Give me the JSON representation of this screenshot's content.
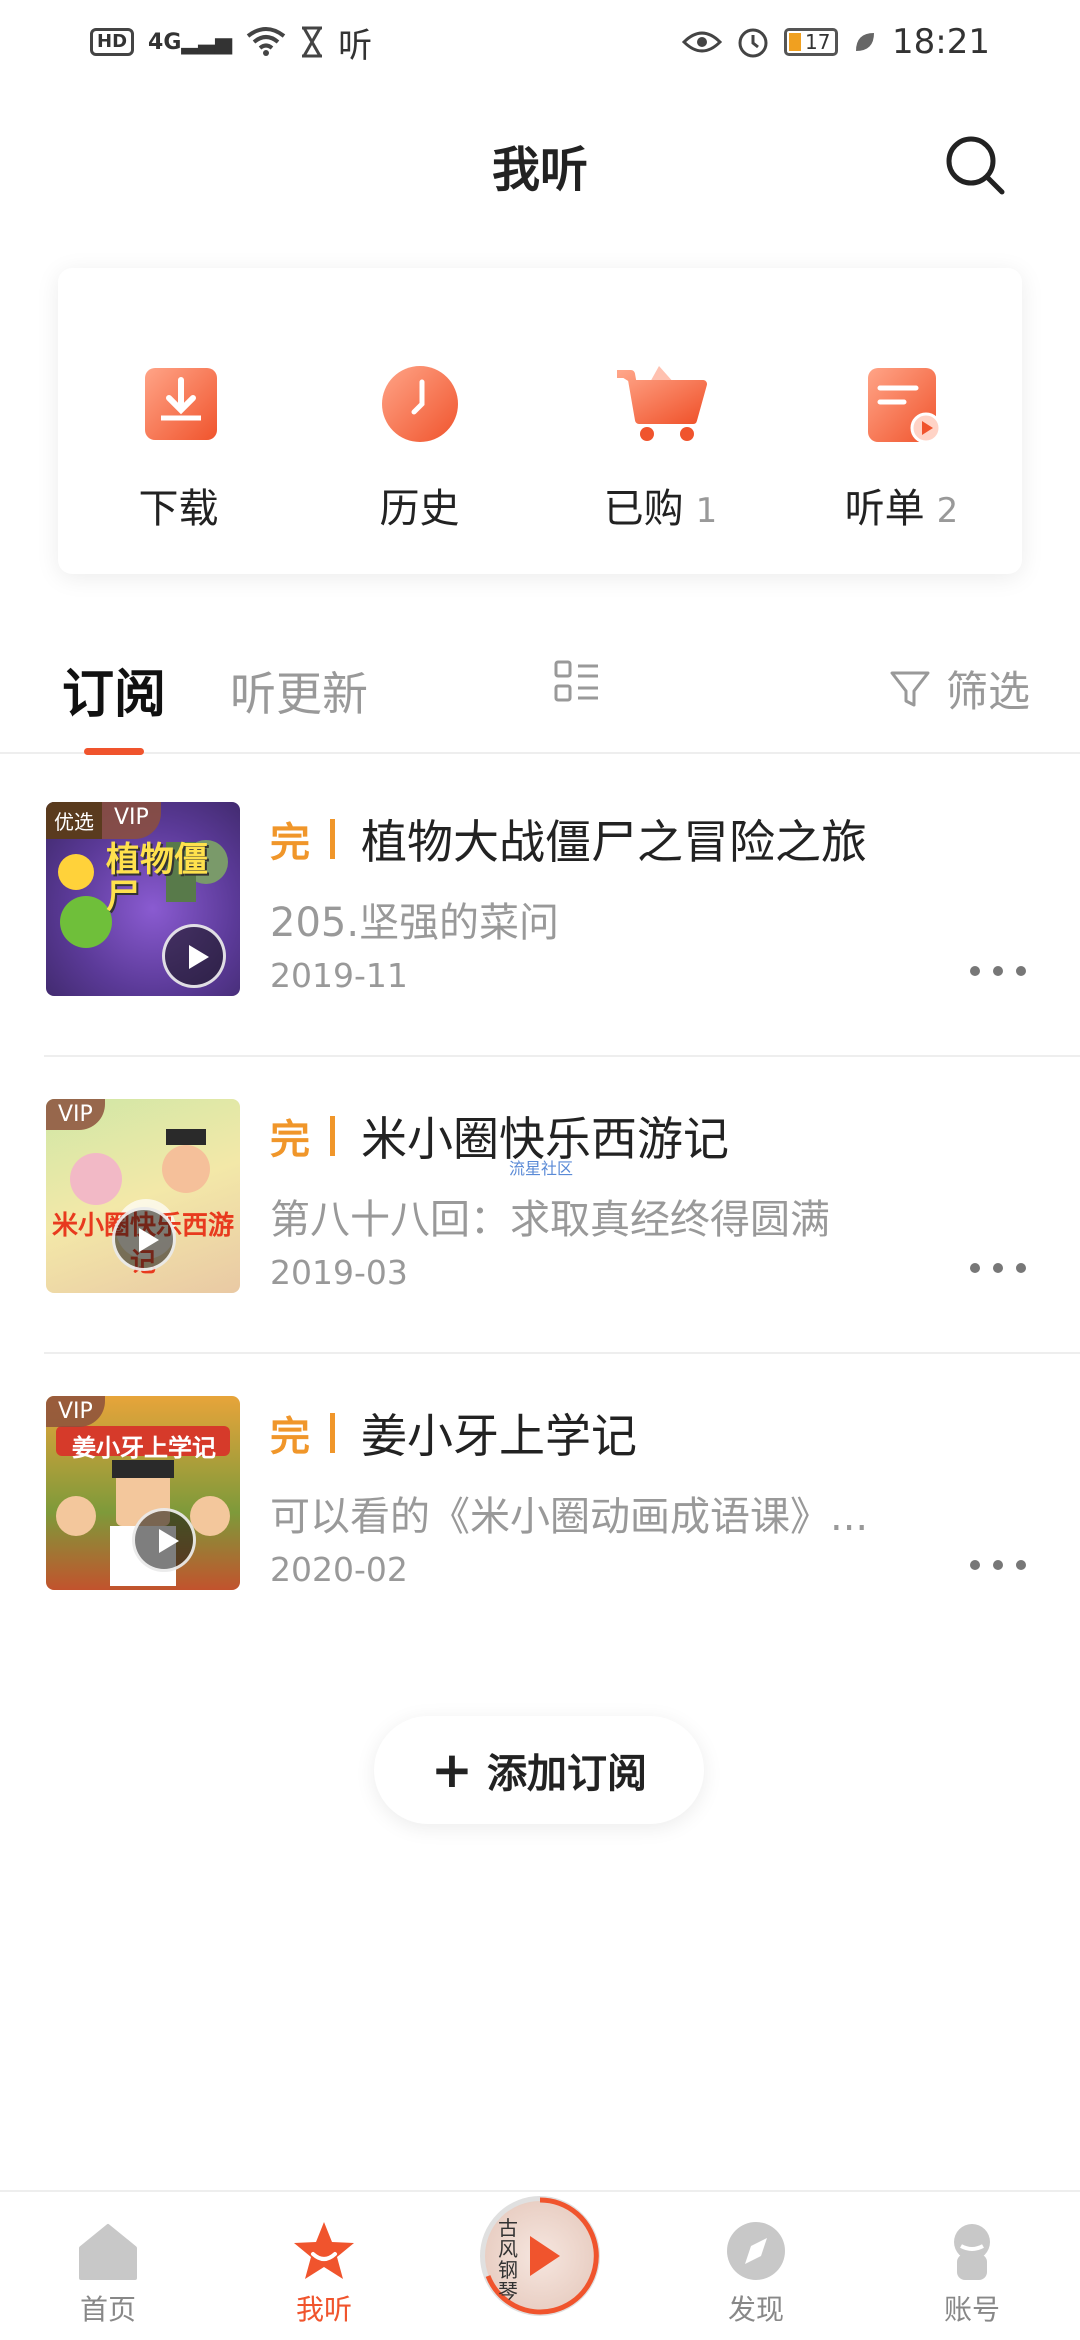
{
  "status_bar": {
    "hd": "HD",
    "signal": "4G",
    "app_glyph": "听",
    "battery": "17",
    "time": "18:21"
  },
  "header": {
    "title": "我听"
  },
  "quick": [
    {
      "label": "下载",
      "count": ""
    },
    {
      "label": "历史",
      "count": ""
    },
    {
      "label": "已购",
      "count": "1"
    },
    {
      "label": "听单",
      "count": "2"
    }
  ],
  "tabs": {
    "active": "订阅",
    "other": "听更新",
    "filter": "筛选"
  },
  "items": [
    {
      "badge_pick": "优选",
      "badge_vip": "VIP",
      "done": "完",
      "title": "植物大战僵尸之冒险之旅",
      "subtitle": "205.坚强的菜问",
      "date": "2019-11",
      "cover_text": "植物僵尸"
    },
    {
      "badge_vip": "VIP",
      "done": "完",
      "title": "米小圈快乐西游记",
      "subtitle": "第八十八回：求取真经终得圆满",
      "date": "2019-03",
      "cover_text": "米小圈快乐西游记"
    },
    {
      "badge_vip": "VIP",
      "done": "完",
      "title": "姜小牙上学记",
      "subtitle": "可以看的《米小圈动画成语课》...",
      "date": "2020-02",
      "cover_text": "姜小牙上学记"
    }
  ],
  "watermark": "流星社区",
  "add_button": "添加订阅",
  "nav": [
    {
      "label": "首页"
    },
    {
      "label": "我听"
    },
    {
      "label": "",
      "player_text": "古风钢琴"
    },
    {
      "label": "发现"
    },
    {
      "label": "账号"
    }
  ],
  "colors": {
    "accent": "#f0542d",
    "done": "#f0962a"
  }
}
